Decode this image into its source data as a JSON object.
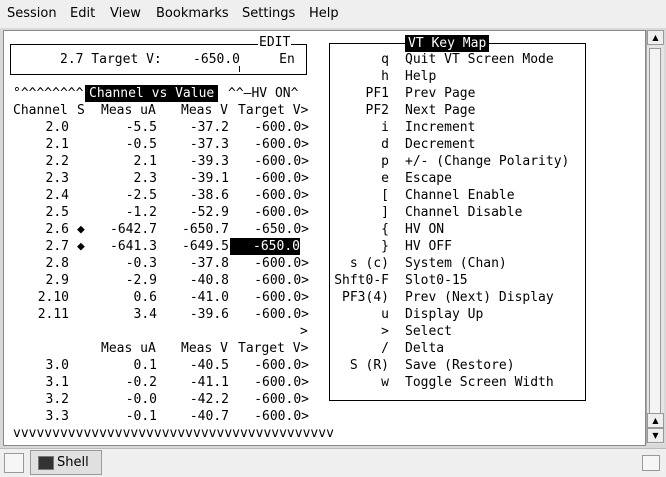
{
  "menu": [
    "Session",
    "Edit",
    "View",
    "Bookmarks",
    "Settings",
    "Help"
  ],
  "edit_box": {
    "title": "EDIT",
    "line": "2.7 Target V:    -650.0     En"
  },
  "table": {
    "header_prefix": "°^^^^^^^^",
    "header_title": "Channel vs Value",
    "header_suffix": "^^—HV ON^",
    "columns": [
      "Channel",
      "S",
      "Meas uA",
      "Meas V",
      "Target V>"
    ],
    "rows": [
      {
        "ch": "2.0",
        "s": "",
        "uA": "-5.5",
        "v": "-37.2",
        "t": "-600.0>"
      },
      {
        "ch": "2.1",
        "s": "",
        "uA": "-0.5",
        "v": "-37.3",
        "t": "-600.0>"
      },
      {
        "ch": "2.2",
        "s": "",
        "uA": "2.1",
        "v": "-39.3",
        "t": "-600.0>"
      },
      {
        "ch": "2.3",
        "s": "",
        "uA": "2.3",
        "v": "-39.1",
        "t": "-600.0>"
      },
      {
        "ch": "2.4",
        "s": "",
        "uA": "-2.5",
        "v": "-38.6",
        "t": "-600.0>"
      },
      {
        "ch": "2.5",
        "s": "",
        "uA": "-1.2",
        "v": "-52.9",
        "t": "-600.0>"
      },
      {
        "ch": "2.6",
        "s": "◆",
        "uA": "-642.7",
        "v": "-650.7",
        "t": "-650.0>"
      },
      {
        "ch": "2.7",
        "s": "◆",
        "uA": "-641.3",
        "v": "-649.5",
        "t": "-650.0",
        "selected": true
      },
      {
        "ch": "2.8",
        "s": "",
        "uA": "-0.3",
        "v": "-37.8",
        "t": "-600.0>"
      },
      {
        "ch": "2.9",
        "s": "",
        "uA": "-2.9",
        "v": "-40.8",
        "t": "-600.0>"
      },
      {
        "ch": "2.10",
        "s": "",
        "uA": "0.6",
        "v": "-41.0",
        "t": "-600.0>"
      },
      {
        "ch": "2.11",
        "s": "",
        "uA": "3.4",
        "v": "-39.6",
        "t": "-600.0>"
      }
    ],
    "spacer": ">",
    "columns2": [
      "Meas uA",
      "Meas V",
      "Target V>"
    ],
    "rows2": [
      {
        "ch": "3.0",
        "uA": "0.1",
        "v": "-40.5",
        "t": "-600.0>"
      },
      {
        "ch": "3.1",
        "uA": "-0.2",
        "v": "-41.1",
        "t": "-600.0>"
      },
      {
        "ch": "3.2",
        "uA": "-0.0",
        "v": "-42.2",
        "t": "-600.0>"
      },
      {
        "ch": "3.3",
        "uA": "-0.1",
        "v": "-40.7",
        "t": "-600.0>"
      }
    ],
    "footer": "vvvvvvvvvvvvvvvvvvvvvvvvvvvvvvvvvvvvvvvvv"
  },
  "keymap": {
    "title": "VT Key Map",
    "items": [
      {
        "key": "q",
        "desc": "Quit VT Screen Mode"
      },
      {
        "key": "h",
        "desc": "Help"
      },
      {
        "key": "PF1",
        "desc": "Prev Page"
      },
      {
        "key": "PF2",
        "desc": "Next Page"
      },
      {
        "key": "i",
        "desc": "Increment"
      },
      {
        "key": "d",
        "desc": "Decrement"
      },
      {
        "key": "p",
        "desc": "+/- (Change Polarity)"
      },
      {
        "key": "e",
        "desc": "Escape"
      },
      {
        "key": "[",
        "desc": "Channel Enable"
      },
      {
        "key": "]",
        "desc": "Channel Disable"
      },
      {
        "key": "{",
        "desc": "HV ON"
      },
      {
        "key": "}",
        "desc": "HV OFF"
      },
      {
        "key": "s (c)",
        "desc": "System (Chan)"
      },
      {
        "key": "Shft0-F",
        "desc": "Slot0-15"
      },
      {
        "key": "PF3(4)",
        "desc": "Prev (Next) Display"
      },
      {
        "key": "u",
        "desc": "Display Up"
      },
      {
        "key": ">",
        "desc": "Select"
      },
      {
        "key": "/",
        "desc": "Delta"
      },
      {
        "key": "S (R)",
        "desc": "Save (Restore)"
      },
      {
        "key": "w",
        "desc": "Toggle Screen Width"
      }
    ]
  },
  "taskbar": {
    "tab_label": "Shell",
    "icons": {
      "new_tab": "new-tab-icon",
      "shell": "terminal-icon"
    }
  }
}
